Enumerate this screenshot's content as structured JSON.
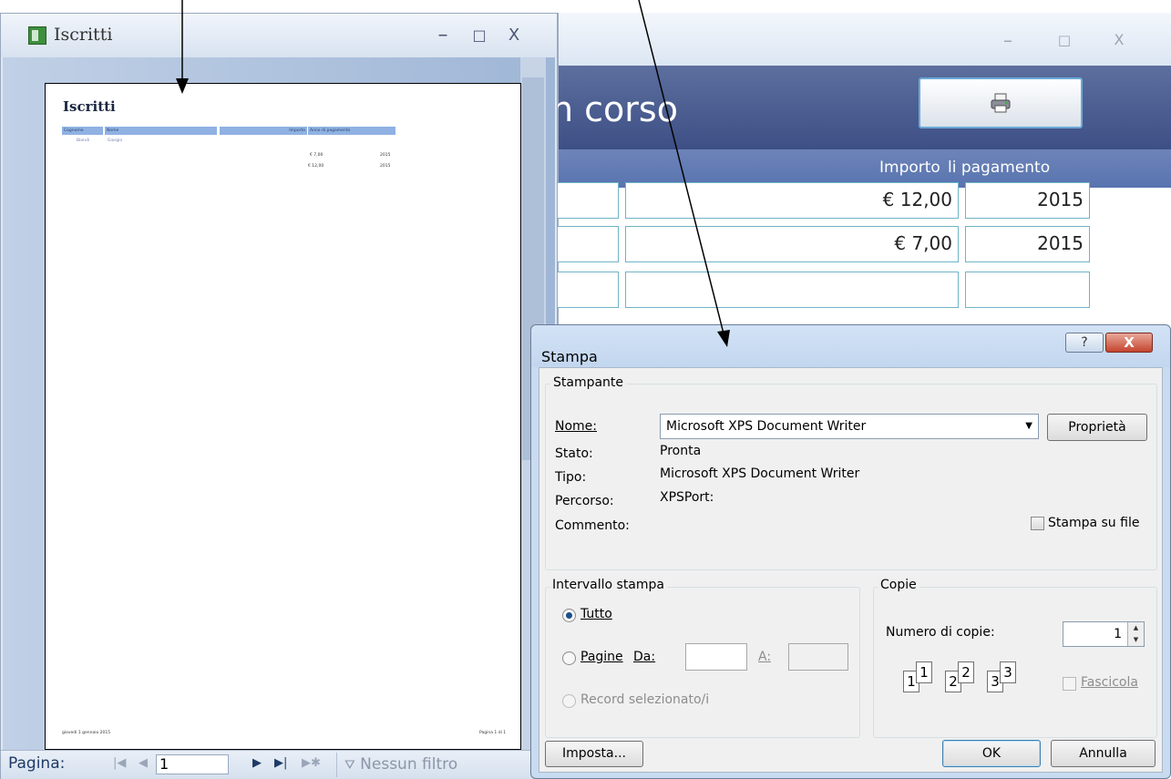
{
  "back_window": {
    "header_title": "n corso",
    "column_labels": [
      "Importo",
      "li pagamento"
    ],
    "rows": [
      {
        "amount": "€ 12,00",
        "year": "2015"
      },
      {
        "amount": "€ 7,00",
        "year": "2015"
      },
      {
        "amount": "",
        "year": ""
      }
    ],
    "controls": {
      "minimize": "–",
      "maximize": "□",
      "close": "X"
    }
  },
  "report_window": {
    "title": "Iscritti",
    "controls": {
      "minimize": "–",
      "maximize": "□",
      "close": "X"
    },
    "report": {
      "title": "Iscritti",
      "columns": [
        "Cognome",
        "Nome",
        "Importo",
        "Anno di pagamento"
      ],
      "record": {
        "cognome": "Biondi",
        "nome": "Giorgio"
      },
      "amounts": [
        {
          "amount": "€ 7,00",
          "year": "2015"
        },
        {
          "amount": "€ 12,00",
          "year": "2015"
        }
      ],
      "footer_date": "giovedì 1 gennaio 2015",
      "footer_page": "Pagina 1 di 1"
    },
    "navigation": {
      "page_label": "Pagina:",
      "page_value": "1",
      "filter_label": "Nessun filtro"
    }
  },
  "print_dialog": {
    "title": "Stampa",
    "help_label": "?",
    "close_label": "X",
    "printer_group": {
      "title": "Stampante",
      "name_label": "Nome:",
      "name_value": "Microsoft XPS Document Writer",
      "properties_button": "Proprietà",
      "status_label": "Stato:",
      "status_value": "Pronta",
      "type_label": "Tipo:",
      "type_value": "Microsoft XPS Document Writer",
      "path_label": "Percorso:",
      "path_value": "XPSPort:",
      "comment_label": "Commento:",
      "print_to_file_label": "Stampa su file"
    },
    "range_group": {
      "title": "Intervallo stampa",
      "all_label": "Tutto",
      "pages_label": "Pagine",
      "from_label": "Da:",
      "to_label": "A:",
      "selected_label": "Record selezionato/i"
    },
    "copies_group": {
      "title": "Copie",
      "copies_label": "Numero di copie:",
      "copies_value": "1",
      "collate_label": "Fascicola",
      "collate_pages": [
        "1",
        "2",
        "3"
      ]
    },
    "setup_button": "Imposta...",
    "ok_button": "OK",
    "cancel_button": "Annulla"
  },
  "colors": {
    "header_band": "#4a5c91",
    "column_band": "#6680b8",
    "cell_border": "#6fb4c6",
    "dialog_frame": "#c9dbf0",
    "close_red": "#c4452f",
    "report_header": "#8fb2e3"
  }
}
